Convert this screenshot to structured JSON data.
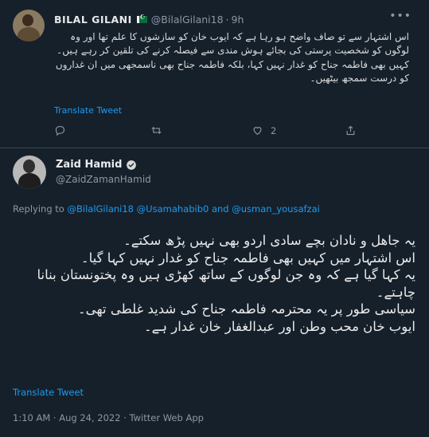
{
  "reply_tweet": {
    "name": "BILAL GILANI",
    "handle": "@BilalGilani18",
    "separator": "·",
    "time": "9h",
    "text_lines": [
      "اس اشتہار سے تو صاف واضح ہو رہا ہے کہ ایوب خان کو سازشوں کا علم تھا اور وہ لوگوں کو شخصیت پرستی کی بجائے ہوش مندی سے فیصلہ کرنے کی تلقین کر رہے ہیں۔",
      "کہیں بھی فاطمہ جناح کو غدار نہیں کہا، بلکہ فاطمہ جناح بھی ناسمجھی میں ان غداروں کو درست سمجھ بیٹھیں۔"
    ],
    "translate_label": "Translate Tweet",
    "actions": {
      "reply_count": "",
      "retweet_count": "",
      "like_count": "2",
      "share_count": ""
    }
  },
  "main_tweet": {
    "name": "Zaid Hamid",
    "handle": "@ZaidZamanHamid",
    "replying_prefix": "Replying to",
    "replying_users": [
      "@BilalGilani18",
      "@Usamahabib0"
    ],
    "replying_and": "and",
    "replying_last": "@usman_yousafzai",
    "text_lines": [
      "یہ جاھل و نادان بچے سادی اردو بھی نہیں پڑھ سکتے۔",
      "اس اشتہار میں کہیں بھی فاطمہ جناح کو غدار نہیں کہا گیا۔",
      "یہ کہا گیا ہے کہ وہ جن لوگوں کے ساتھ کھڑی ہیں وہ پختونستان بنانا چاہتے۔",
      "سیاسی طور پر یہ محترمہ فاطمہ جناح کی شدید غلطی تھی۔",
      "ایوب خان محب وطن اور عبدالغفار خان غدار ہے۔"
    ],
    "translate_label": "Translate Tweet",
    "meta": "1:10 AM · Aug 24, 2022 · Twitter Web App"
  },
  "colors": {
    "background": "#15202b",
    "link": "#1d9bf0",
    "muted": "#8b98a5",
    "divider": "#38444d"
  }
}
